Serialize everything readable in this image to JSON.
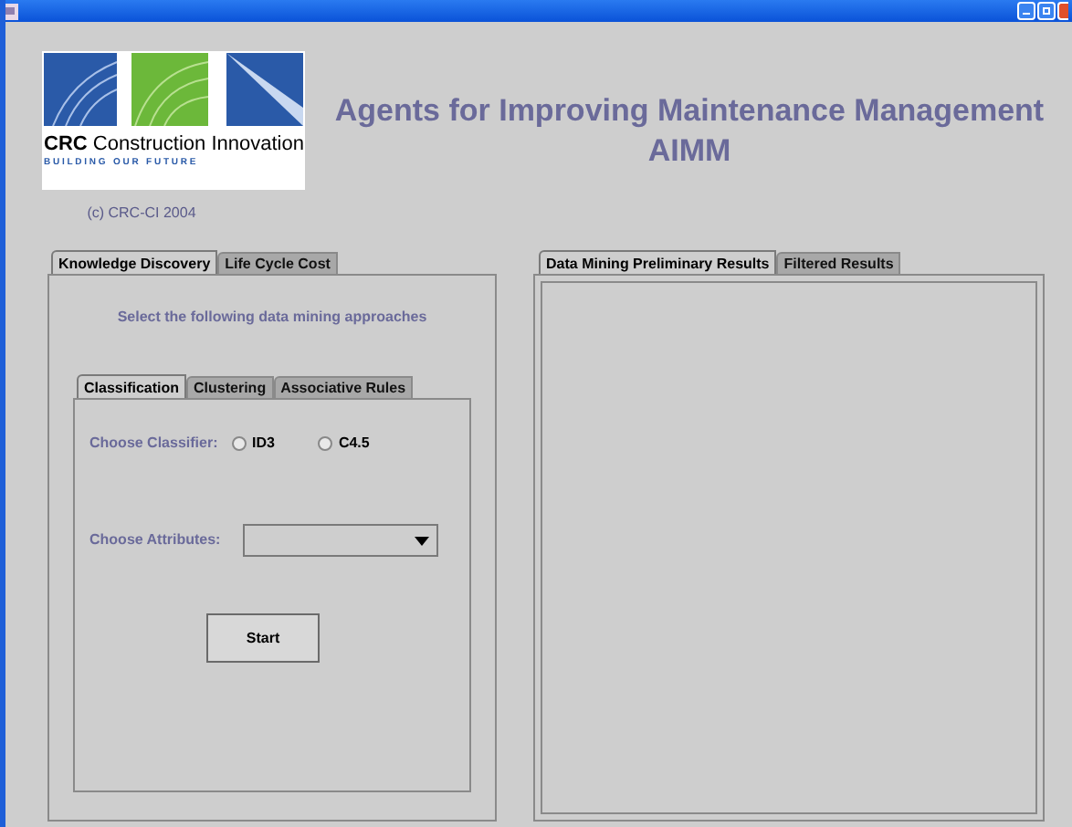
{
  "logo": {
    "name_bold": "CRC",
    "name_rest": "Construction Innovation",
    "tagline": "B U I L D I N G   O U R   F U T U R E",
    "copyright": "(c) CRC-CI 2004"
  },
  "title": {
    "line_1": "Agents for Improving Maintenance Management",
    "line_2": "AIMM"
  },
  "left_tabs": [
    {
      "label": "Knowledge Discovery",
      "selected": true
    },
    {
      "label": "Life Cycle Cost",
      "selected": false
    }
  ],
  "instruction": "Select the following data mining approaches",
  "inner_tabs": [
    {
      "label": "Classification",
      "selected": true
    },
    {
      "label": "Clustering",
      "selected": false
    },
    {
      "label": "Associative Rules",
      "selected": false
    }
  ],
  "classifier": {
    "label": "Choose Classifier:",
    "options": [
      {
        "label": "ID3",
        "selected": false
      },
      {
        "label": "C4.5",
        "selected": false
      }
    ]
  },
  "attributes": {
    "label": "Choose Attributes:"
  },
  "start_button": "Start",
  "right_tabs": [
    {
      "label": "Data Mining Preliminary Results",
      "selected": true
    },
    {
      "label": "Filtered Results",
      "selected": false
    }
  ]
}
